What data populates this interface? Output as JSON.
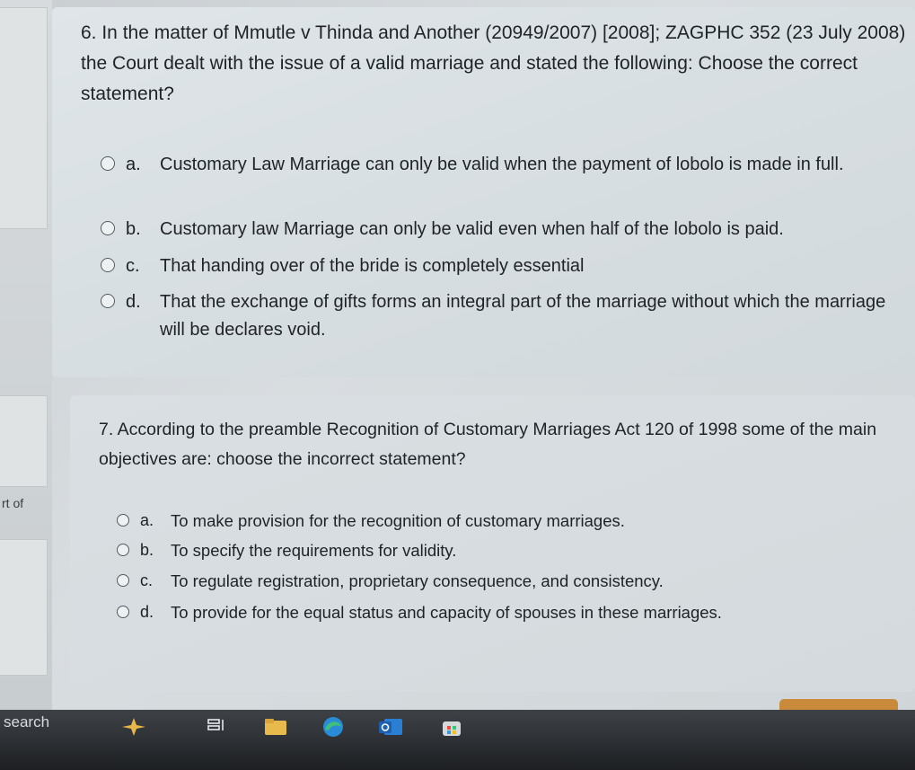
{
  "left_panel": {
    "fragment": "rt of"
  },
  "question6": {
    "text": "6. In the matter of Mmutle v Thinda and Another (20949/2007) [2008]; ZAGPHC 352 (23 July 2008) the Court dealt with the issue of a valid marriage and stated the following: Choose the correct statement?",
    "options": [
      {
        "letter": "a.",
        "text": "Customary Law Marriage can only be valid when the payment of lobolo is made in full."
      },
      {
        "letter": "b.",
        "text": "Customary law Marriage can only be valid even when half of the lobolo is paid."
      },
      {
        "letter": "c.",
        "text": "That handing over of the bride is completely essential"
      },
      {
        "letter": "d.",
        "text": "That the exchange of gifts forms an integral part of the marriage without which the marriage will be declares void."
      }
    ]
  },
  "question7": {
    "text": "7. According to the preamble Recognition of Customary Marriages Act 120 of 1998 some of the main objectives are: choose the incorrect statement?",
    "options": [
      {
        "letter": "a.",
        "text": "To make provision for the recognition of customary marriages."
      },
      {
        "letter": "b.",
        "text": "To specify the requirements for validity."
      },
      {
        "letter": "c.",
        "text": "To regulate registration, proprietary consequence, and consistency."
      },
      {
        "letter": "d.",
        "text": "To provide for the equal status and capacity of spouses in these marriages."
      }
    ]
  },
  "taskbar": {
    "search_label": "search",
    "icons": [
      "copilot-icon",
      "task-view-icon",
      "file-explorer-icon",
      "edge-icon",
      "outlook-icon",
      "store-icon"
    ]
  }
}
